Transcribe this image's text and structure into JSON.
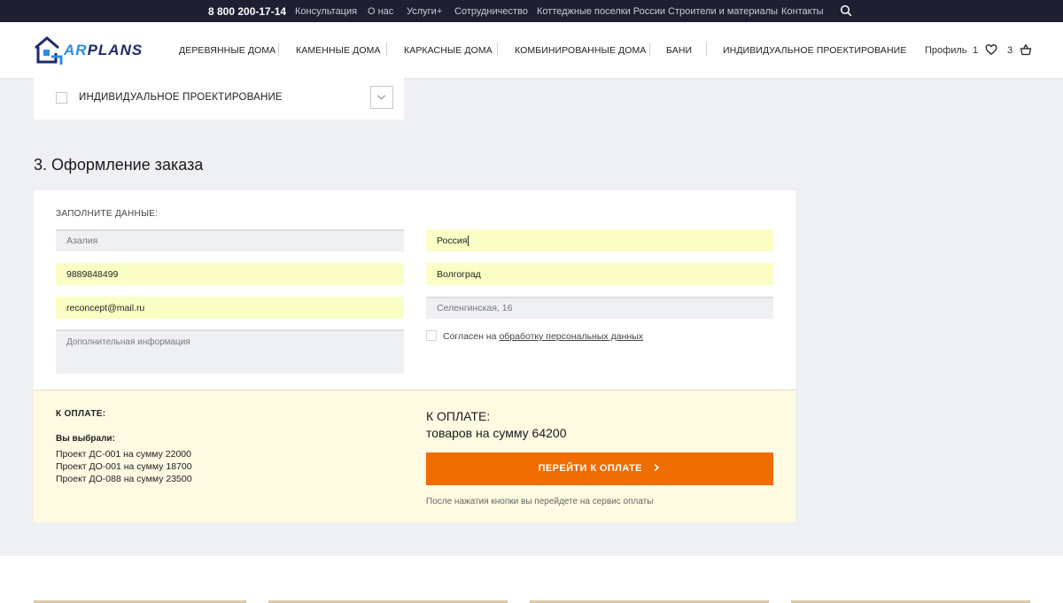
{
  "topbar": {
    "phone": "8 800 200-17-14",
    "links": [
      "Консультация",
      "О нас",
      "Услуги+",
      "Сотрудничество",
      "Коттеджные поселки России",
      "Строители и материалы",
      "Контакты"
    ]
  },
  "header": {
    "logo_ar": "AR",
    "logo_rest": "PLANS",
    "nav": [
      "ДЕРЕВЯННЫЕ ДОМА",
      "КАМЕННЫЕ ДОМА",
      "КАРКАСНЫЕ ДОМА",
      "КОМБИНИРОВАННЫЕ ДОМА",
      "БАНИ",
      "ИНДИВИДУАЛЬНОЕ ПРОЕКТИРОВАНИЕ"
    ],
    "profile": "Профиль",
    "favorites_count": "1",
    "cart_count": "3"
  },
  "filter": {
    "label": "ИНДИВИДУАЛЬНОЕ ПРОЕКТИРОВАНИЕ"
  },
  "section_title": "3. Оформление заказа",
  "form": {
    "subtitle": "ЗАПОЛНИТЕ ДАННЫЕ:",
    "name_placeholder": "Азалия",
    "phone_value": "9889848499",
    "email_value": "reconcept@mail.ru",
    "info_placeholder": "Дополнительная информация",
    "country_value": "Россия",
    "city_value": "Волгоград",
    "address_placeholder": "Селенгинская, 16",
    "consent_text": "Согласен на",
    "consent_link": "обработку персональных данных"
  },
  "payment": {
    "left_title": "К ОПЛАТЕ:",
    "chosen_label": "Вы выбрали:",
    "items": [
      "Проект ДС-001 на сумму 22000",
      "Проект ДО-001 на сумму 18700",
      "Проект ДО-088 на сумму 23500"
    ],
    "right_title": "К ОПЛАТЕ:",
    "total": "товаров на сумму 64200",
    "button_label": "ПЕРЕЙТИ К ОПЛАТЕ",
    "note": "После нажатия кнопки вы перейдете на сервис оплаты"
  },
  "colors": {
    "topbar_bg": "#1f1f33",
    "accent_orange": "#ef6c00",
    "filled_field": "#fbffc5",
    "payment_bg": "#fffae2"
  },
  "icons": [
    "search-icon",
    "logo-house-icon",
    "heart-icon",
    "cart-icon",
    "chevron-down-icon",
    "chevron-right-icon"
  ]
}
